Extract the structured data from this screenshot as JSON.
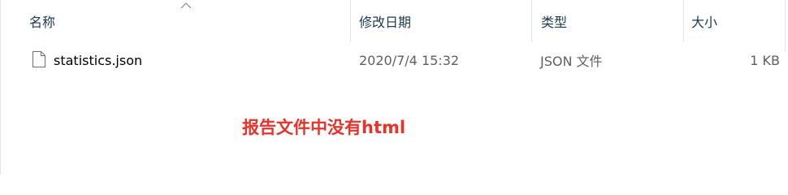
{
  "header": {
    "name": "名称",
    "modified": "修改日期",
    "type": "类型",
    "size": "大小"
  },
  "files": [
    {
      "name": "statistics.json",
      "modified": "2020/7/4 15:32",
      "type": "JSON 文件",
      "size": "1 KB"
    }
  ],
  "annotation": {
    "text": "报告文件中没有html",
    "color": "#e8332a"
  },
  "icons": {
    "sort": "chevron-up-icon",
    "file": "file-icon"
  },
  "colors": {
    "header_text": "#1e3950",
    "meta_text": "#5f5f5f"
  }
}
